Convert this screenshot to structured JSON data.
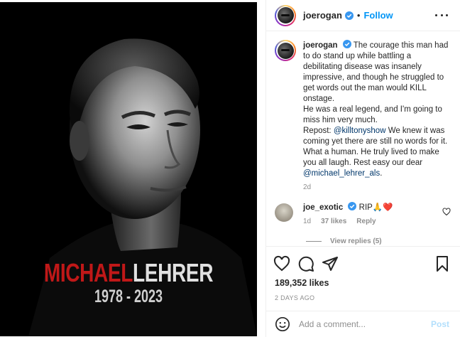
{
  "post_image": {
    "first_name": "MICHAEL",
    "last_name": "LEHRER",
    "years": "1978 - 2023"
  },
  "header": {
    "username": "joerogan",
    "separator": "•",
    "follow_label": "Follow"
  },
  "caption": {
    "username": "joerogan",
    "text_1": "The courage this man had to do stand up while battling a debilitating disease was insanely impressive, and though he struggled to get words out the man would KILL onstage.",
    "text_2": "He was a real legend, and I'm going to miss him very much.",
    "repost_prefix": "Repost: ",
    "mention_1": "@killtonyshow",
    "text_3": " We knew it was coming yet there are still no words for it. What a human. He truly lived to make you all laugh. Rest easy our dear ",
    "mention_2": "@michael_lehrer_als",
    "text_4": ".",
    "time": "2d"
  },
  "comment": {
    "username": "joe_exotic",
    "text": "RIP🙏❤️",
    "time": "1d",
    "likes": "37 likes",
    "reply_label": "Reply",
    "view_replies": "View replies (5)"
  },
  "actions": {
    "likes_count": "189,352 likes",
    "time_ago": "2 DAYS AGO"
  },
  "add_comment": {
    "placeholder": "Add a comment...",
    "post_label": "Post"
  },
  "colors": {
    "verified": "#3897f0",
    "follow": "#0095f6",
    "mention": "#00376b",
    "name_red": "#c01818"
  },
  "icons": [
    "verified-icon",
    "more-options-icon",
    "heart-icon",
    "comment-icon",
    "share-icon",
    "bookmark-icon",
    "emoji-icon"
  ]
}
